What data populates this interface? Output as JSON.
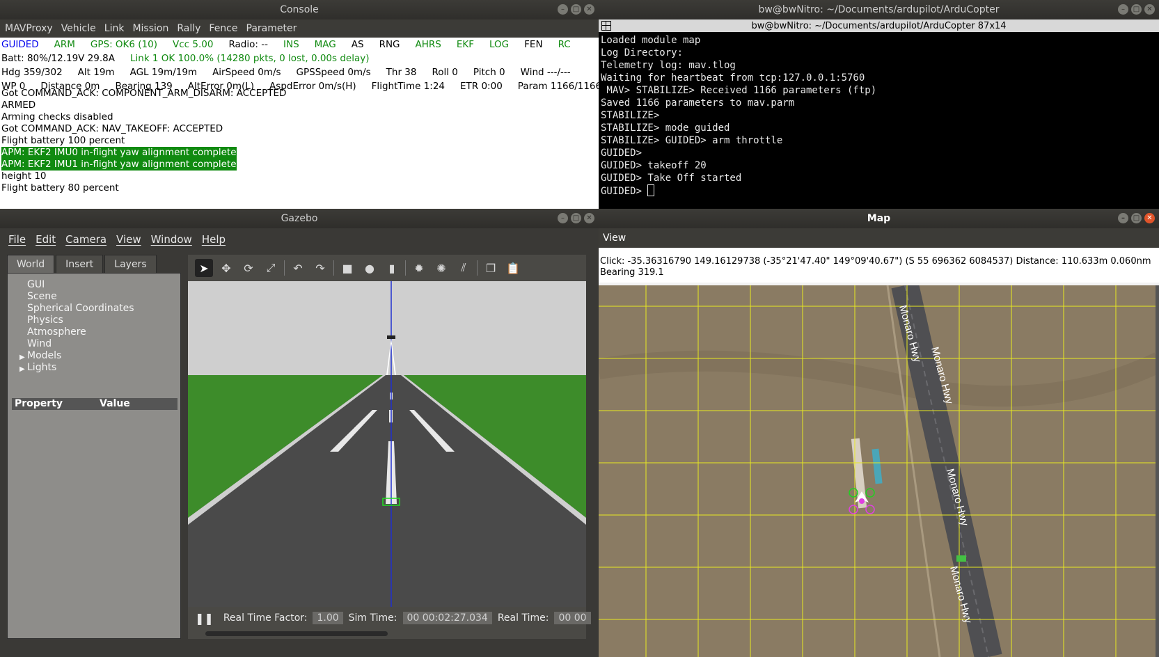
{
  "console": {
    "title": "Console",
    "menu": [
      "MAVProxy",
      "Vehicle",
      "Link",
      "Mission",
      "Rally",
      "Fence",
      "Parameter"
    ],
    "status_row1": [
      {
        "text": "GUIDED",
        "color": "#0000ee"
      },
      {
        "text": "ARM",
        "color": "#108a10"
      },
      {
        "text": "GPS: OK6 (10)",
        "color": "#108a10"
      },
      {
        "text": "Vcc 5.00",
        "color": "#108a10"
      },
      {
        "text": "Radio: --",
        "color": "#000000"
      },
      {
        "text": "INS",
        "color": "#108a10"
      },
      {
        "text": "MAG",
        "color": "#108a10"
      },
      {
        "text": "AS",
        "color": "#000000"
      },
      {
        "text": "RNG",
        "color": "#000000"
      },
      {
        "text": "AHRS",
        "color": "#108a10"
      },
      {
        "text": "EKF",
        "color": "#108a10"
      },
      {
        "text": "LOG",
        "color": "#108a10"
      },
      {
        "text": "FEN",
        "color": "#000000"
      },
      {
        "text": "RC",
        "color": "#108a10"
      }
    ],
    "status_row2": [
      {
        "text": "Batt: 80%/12.19V 29.8A",
        "color": "#000000"
      },
      {
        "text": "Link 1 OK 100.0% (14280 pkts, 0 lost, 0.00s delay)",
        "color": "#108a10"
      }
    ],
    "status_row3": [
      "Hdg 359/302",
      "Alt 19m",
      "AGL 19m/19m",
      "AirSpeed 0m/s",
      "GPSSpeed 0m/s",
      "Thr 38",
      "Roll 0",
      "Pitch 0",
      "Wind ---/---"
    ],
    "status_row4": [
      "WP 0",
      "Distance 0m",
      "Bearing 139",
      "AltError 0m(L)",
      "AspdError 0m/s(H)",
      "FlightTime 1:24",
      "ETR 0:00",
      "Param 1166/1166"
    ],
    "messages": [
      {
        "text": "Got COMMAND_ACK: COMPONENT_ARM_DISARM: ACCEPTED",
        "highlight": false
      },
      {
        "text": "ARMED",
        "highlight": false
      },
      {
        "text": "Arming checks disabled",
        "highlight": false
      },
      {
        "text": "Got COMMAND_ACK: NAV_TAKEOFF: ACCEPTED",
        "highlight": false
      },
      {
        "text": "Flight battery 100 percent",
        "highlight": false
      },
      {
        "text": "APM: EKF2 IMU0 in-flight yaw alignment complete",
        "highlight": true
      },
      {
        "text": "APM: EKF2 IMU1 in-flight yaw alignment complete",
        "highlight": true
      },
      {
        "text": "height 10",
        "highlight": false
      },
      {
        "text": "Flight battery 80 percent",
        "highlight": false
      }
    ]
  },
  "terminal": {
    "title": "bw@bwNitro: ~/Documents/ardupilot/ArduCopter",
    "subtitle": "bw@bwNitro: ~/Documents/ardupilot/ArduCopter 87x14",
    "lines": [
      "Loaded module map",
      "Log Directory:",
      "Telemetry log: mav.tlog",
      "Waiting for heartbeat from tcp:127.0.0.1:5760",
      " MAV> STABILIZE> Received 1166 parameters (ftp)",
      "Saved 1166 parameters to mav.parm",
      "",
      "STABILIZE>",
      "STABILIZE> mode guided",
      "STABILIZE> GUIDED> arm throttle",
      "GUIDED>",
      "GUIDED> takeoff 20",
      "GUIDED> Take Off started"
    ],
    "prompt": "GUIDED> "
  },
  "gazebo": {
    "title": "Gazebo",
    "menu": [
      "File",
      "Edit",
      "Camera",
      "View",
      "Window",
      "Help"
    ],
    "tabs": [
      "World",
      "Insert",
      "Layers"
    ],
    "tree": [
      {
        "label": "GUI",
        "expandable": false
      },
      {
        "label": "Scene",
        "expandable": false
      },
      {
        "label": "Spherical Coordinates",
        "expandable": false
      },
      {
        "label": "Physics",
        "expandable": false
      },
      {
        "label": "Atmosphere",
        "expandable": false
      },
      {
        "label": "Wind",
        "expandable": false
      },
      {
        "label": "Models",
        "expandable": true
      },
      {
        "label": "Lights",
        "expandable": true
      }
    ],
    "property_header": "Property",
    "value_header": "Value",
    "toolbar_icons": [
      "select-arrow-icon",
      "translate-icon",
      "rotate-icon",
      "scale-icon",
      "undo-icon",
      "redo-icon",
      "box-icon",
      "sphere-icon",
      "cylinder-icon",
      "point-light-icon",
      "spot-light-icon",
      "directional-light-icon",
      "copy-icon",
      "paste-icon"
    ],
    "real_time_factor_label": "Real Time Factor:",
    "real_time_factor": "1.00",
    "sim_time_label": "Sim Time:",
    "sim_time": "00 00:02:27.034",
    "real_time_label": "Real Time:",
    "real_time": "00 00"
  },
  "map": {
    "title": "Map",
    "menu": [
      "View"
    ],
    "click_info": "Click: -35.36316790 149.16129738 (-35°21'47.40\" 149°09'40.67\") (S 55 696362 6084537)  Distance: 110.633m 0.060nm",
    "bearing": "Bearing 319.1",
    "road_labels": [
      "Monaro Hwy",
      "Monaro Hwy",
      "Monaro Hwy",
      "Monaro Hwy"
    ]
  }
}
